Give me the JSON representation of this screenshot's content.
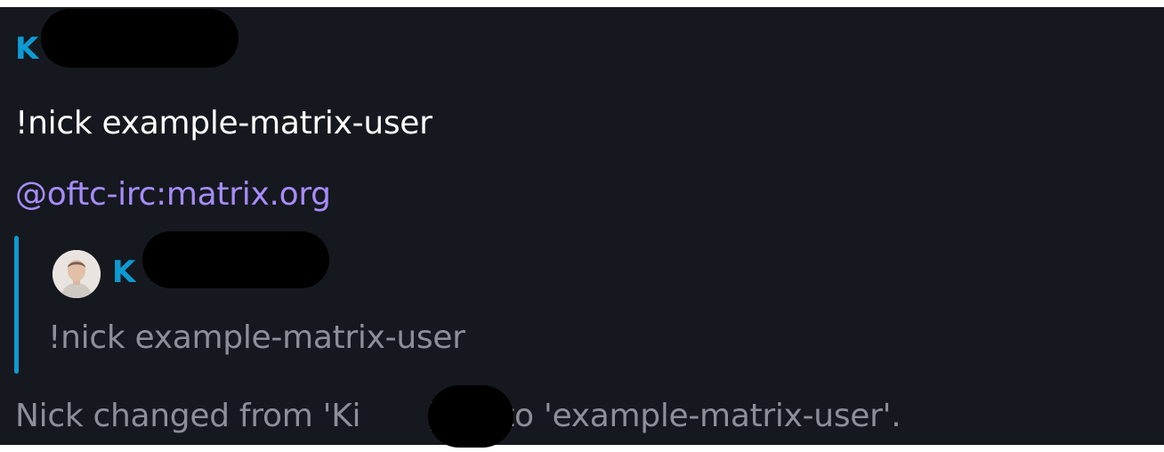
{
  "message": {
    "sender": "K",
    "text": "!nick example-matrix-user",
    "mention": "@oftc-irc:matrix.org"
  },
  "quote": {
    "avatar_icon": "user-avatar-icon",
    "sender": "K",
    "text": "!nick example-matrix-user"
  },
  "status": {
    "part1": "Nick changed from 'Ki",
    "part2": "[m]' to 'example-matrix-user'."
  },
  "colors": {
    "background": "#15181e",
    "sender": "#0d9bd3",
    "mention": "#a78bfa",
    "muted_text": "#8a8f98",
    "quote_bar": "#0d9bd3"
  }
}
